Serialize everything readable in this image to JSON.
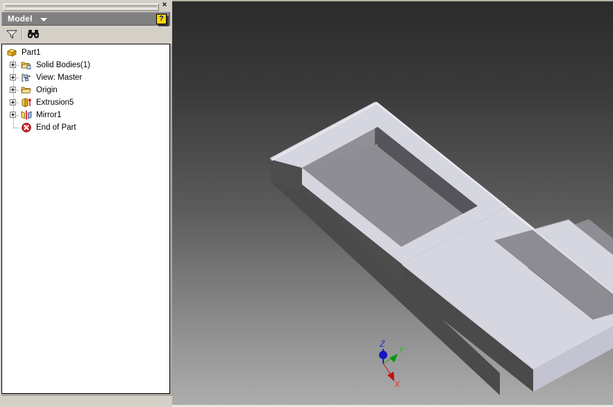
{
  "app": {
    "kind": "cad-modeling-application"
  },
  "browser_panel": {
    "close_label": "×",
    "title": "Model",
    "title_caret_icon": "chevron-down-icon",
    "help_label": "?",
    "toolbar": [
      {
        "name": "filter-icon",
        "label": "Filter"
      },
      {
        "name": "find-icon",
        "label": "Find"
      }
    ],
    "tree": [
      {
        "label": "Part1",
        "icon": "part-box-icon",
        "depth": 0,
        "expandable": false,
        "last": false
      },
      {
        "label": "Solid Bodies(1)",
        "icon": "solid-bodies-icon",
        "depth": 1,
        "expandable": true,
        "last": false
      },
      {
        "label": "View: Master",
        "icon": "view-master-icon",
        "depth": 1,
        "expandable": true,
        "last": false
      },
      {
        "label": "Origin",
        "icon": "folder-icon",
        "depth": 1,
        "expandable": true,
        "last": false
      },
      {
        "label": "Extrusion5",
        "icon": "extrusion-icon",
        "depth": 1,
        "expandable": true,
        "last": false
      },
      {
        "label": "Mirror1",
        "icon": "mirror-icon",
        "depth": 1,
        "expandable": true,
        "last": false
      },
      {
        "label": "End of Part",
        "icon": "end-of-part-icon",
        "depth": 1,
        "expandable": false,
        "last": true
      }
    ]
  },
  "viewport": {
    "background_top": "#2b2b2b",
    "background_bottom": "#adadad",
    "model_name": "mirrored-rectangular-tray",
    "face_colors": {
      "top": "#d2d2dd",
      "outer_side_light": "#c6c6d2",
      "outer_side_dark": "#4a4a4a",
      "inner_wall_dark": "#58585c",
      "inner_floor": "#8e8e93",
      "rim": "#dcdce4"
    },
    "axis_triad": {
      "name": "view-cube-axis-triad",
      "axes": [
        {
          "label": "Z",
          "color": "#0000cc"
        },
        {
          "label": "Y",
          "color": "#00aa00"
        },
        {
          "label": "X",
          "color": "#cc0000"
        }
      ]
    }
  }
}
